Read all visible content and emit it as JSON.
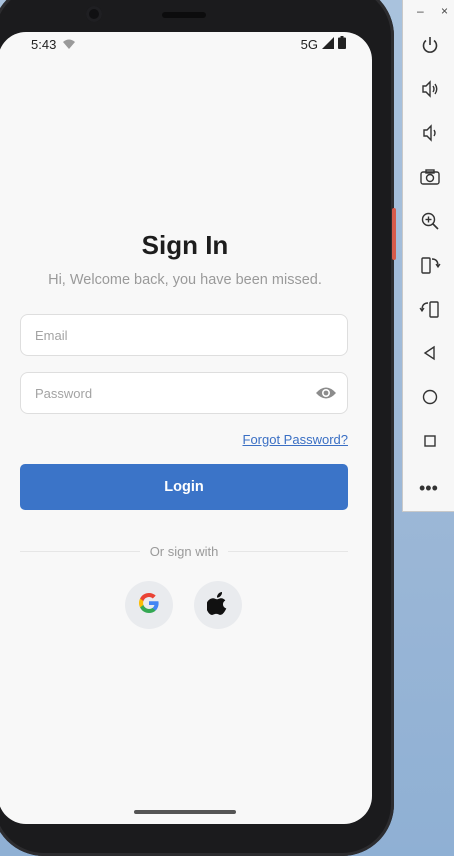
{
  "status_bar": {
    "time": "5:43",
    "network": "5G"
  },
  "login_screen": {
    "title": "Sign In",
    "subtitle": "Hi, Welcome back, you have been missed.",
    "email": {
      "placeholder": "Email",
      "value": ""
    },
    "password": {
      "placeholder": "Password",
      "value": ""
    },
    "forgot_password": "Forgot Password?",
    "login_button": "Login",
    "divider_text": "Or sign with",
    "social": [
      {
        "icon": "google-icon"
      },
      {
        "icon": "apple-icon"
      }
    ]
  },
  "emulator_toolbar": {
    "minimize": "–",
    "close": "×",
    "buttons": [
      "power-icon",
      "volume-up-icon",
      "volume-down-icon",
      "camera-icon",
      "zoom-icon",
      "rotate-left-icon",
      "rotate-right-icon",
      "back-icon",
      "home-icon",
      "overview-icon"
    ],
    "more": "•••"
  },
  "colors": {
    "accent": "#3b74c8",
    "link": "#3a6fc4",
    "screen_bg": "#f8f8f8",
    "desktop_bg": "#9db8d7"
  }
}
